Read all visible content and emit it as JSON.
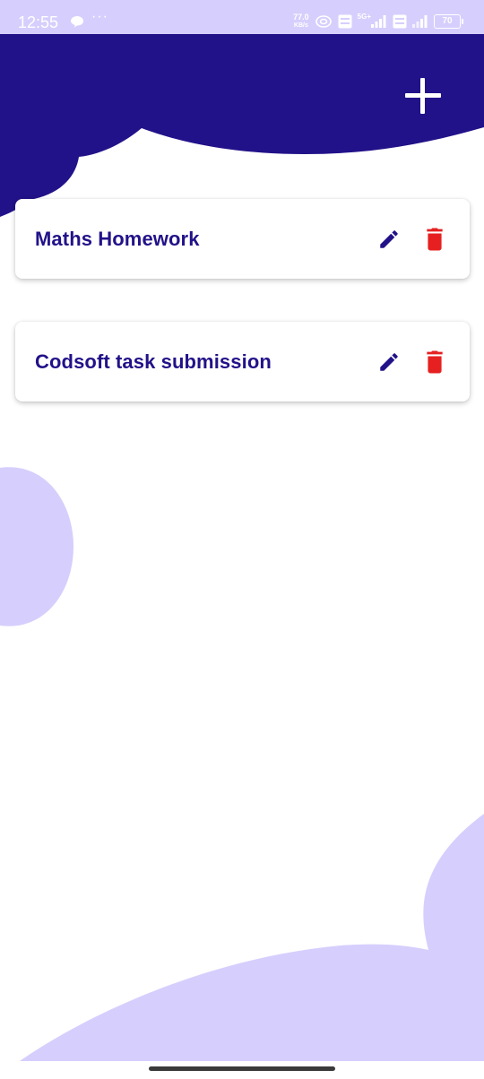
{
  "status_bar": {
    "time": "12:55",
    "network_speed_value": "77.0",
    "network_speed_unit": "KB/s",
    "network_type": "5G+",
    "battery_level": "70"
  },
  "colors": {
    "primary": "#221289",
    "accent_light": "#d6cffd",
    "delete": "#e62020",
    "card_background": "#ffffff"
  },
  "header": {
    "add_icon": "plus-icon"
  },
  "tasks": [
    {
      "title": "Maths Homework",
      "edit_icon": "pencil-icon",
      "delete_icon": "trash-icon"
    },
    {
      "title": "Codsoft task submission",
      "edit_icon": "pencil-icon",
      "delete_icon": "trash-icon"
    }
  ]
}
